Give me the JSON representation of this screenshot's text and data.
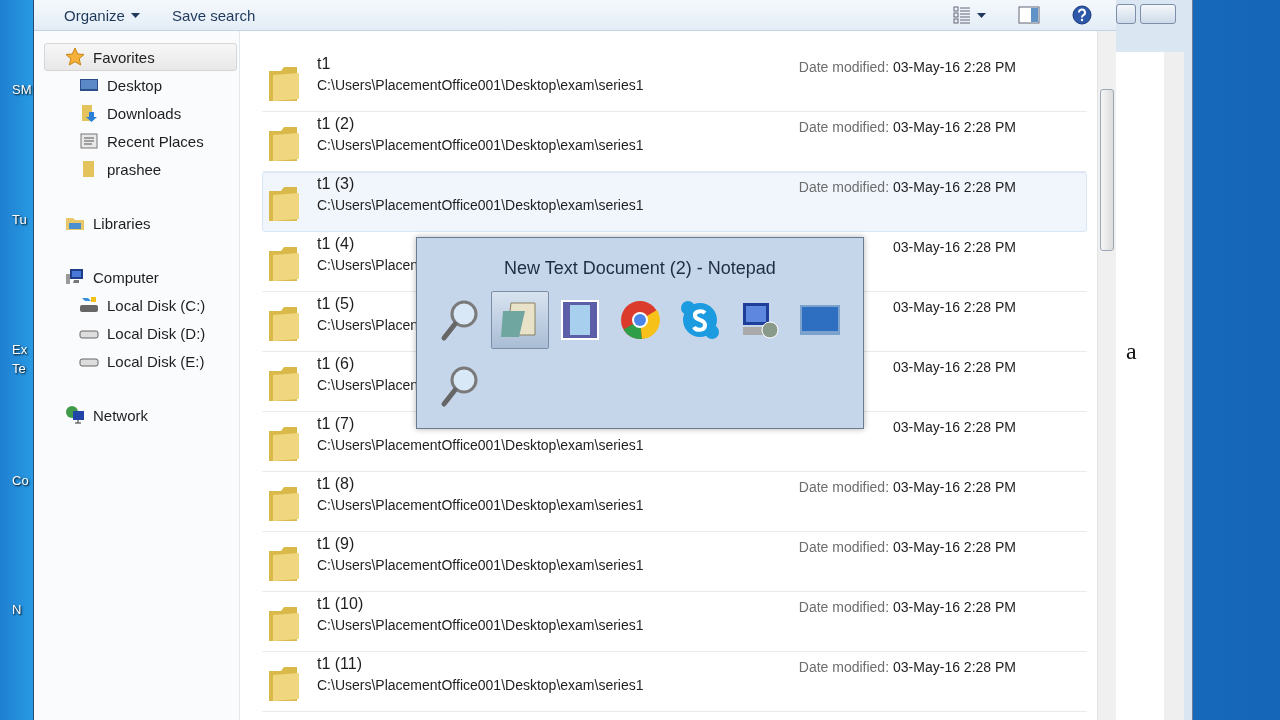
{
  "desktop": {
    "labels": [
      "SM",
      "Tu",
      "Ex",
      "Te",
      "Co",
      "N"
    ]
  },
  "notepad": {
    "text": "a"
  },
  "toolbar": {
    "organize": "Organize",
    "save_search": "Save search"
  },
  "navigation": [
    {
      "label": "Favorites",
      "selected": true,
      "children": [
        {
          "label": "Desktop",
          "selected": false
        },
        {
          "label": "Downloads",
          "selected": false
        },
        {
          "label": "Recent Places",
          "selected": false
        },
        {
          "label": "prashee",
          "selected": false
        }
      ]
    },
    {
      "label": "Libraries",
      "selected": false
    },
    {
      "label": "Computer",
      "selected": false,
      "children": [
        {
          "label": "Local Disk (C:)",
          "selected": false
        },
        {
          "label": "Local Disk (D:)",
          "selected": false
        },
        {
          "label": "Local Disk (E:)",
          "selected": false
        }
      ]
    },
    {
      "label": "Network",
      "selected": false
    }
  ],
  "files": [
    {
      "name": "t1",
      "path": "C:\\Users\\PlacementOffice001\\Desktop\\exam\\series1",
      "date_label": "Date modified:",
      "date": "03-May-16 2:28 PM",
      "selected": false
    },
    {
      "name": "t1 (2)",
      "path": "C:\\Users\\PlacementOffice001\\Desktop\\exam\\series1",
      "date_label": "Date modified:",
      "date": "03-May-16 2:28 PM",
      "selected": false
    },
    {
      "name": "t1 (3)",
      "path": "C:\\Users\\PlacementOffice001\\Desktop\\exam\\series1",
      "date_label": "Date modified:",
      "date": "03-May-16 2:28 PM",
      "selected": true
    },
    {
      "name": "t1 (4)",
      "path": "C:\\Users\\Placen",
      "date": "03-May-16 2:28 PM",
      "selected": false
    },
    {
      "name": "t1 (5)",
      "path": "C:\\Users\\Placen",
      "date": "03-May-16 2:28 PM",
      "selected": false
    },
    {
      "name": "t1 (6)",
      "path": "C:\\Users\\Placen",
      "date": "03-May-16 2:28 PM",
      "selected": false
    },
    {
      "name": "t1 (7)",
      "path": "C:\\Users\\PlacementOffice001\\Desktop\\exam\\series1",
      "date": "03-May-16 2:28 PM",
      "selected": false
    },
    {
      "name": "t1 (8)",
      "path": "C:\\Users\\PlacementOffice001\\Desktop\\exam\\series1",
      "date_label": "Date modified:",
      "date": "03-May-16 2:28 PM",
      "selected": false
    },
    {
      "name": "t1 (9)",
      "path": "C:\\Users\\PlacementOffice001\\Desktop\\exam\\series1",
      "date_label": "Date modified:",
      "date": "03-May-16 2:28 PM",
      "selected": false
    },
    {
      "name": "t1 (10)",
      "path": "C:\\Users\\PlacementOffice001\\Desktop\\exam\\series1",
      "date_label": "Date modified:",
      "date": "03-May-16 2:28 PM",
      "selected": false
    },
    {
      "name": "t1 (11)",
      "path": "C:\\Users\\PlacementOffice001\\Desktop\\exam\\series1",
      "date_label": "Date modified:",
      "date": "03-May-16 2:28 PM",
      "selected": false
    }
  ],
  "switcher": {
    "title": "New Text Document (2) - Notepad",
    "icons": [
      {
        "selected": false
      },
      {
        "selected": true
      },
      {
        "selected": false
      },
      {
        "selected": false
      },
      {
        "selected": false
      },
      {
        "selected": false
      },
      {
        "selected": false
      },
      {
        "selected": false
      }
    ]
  }
}
